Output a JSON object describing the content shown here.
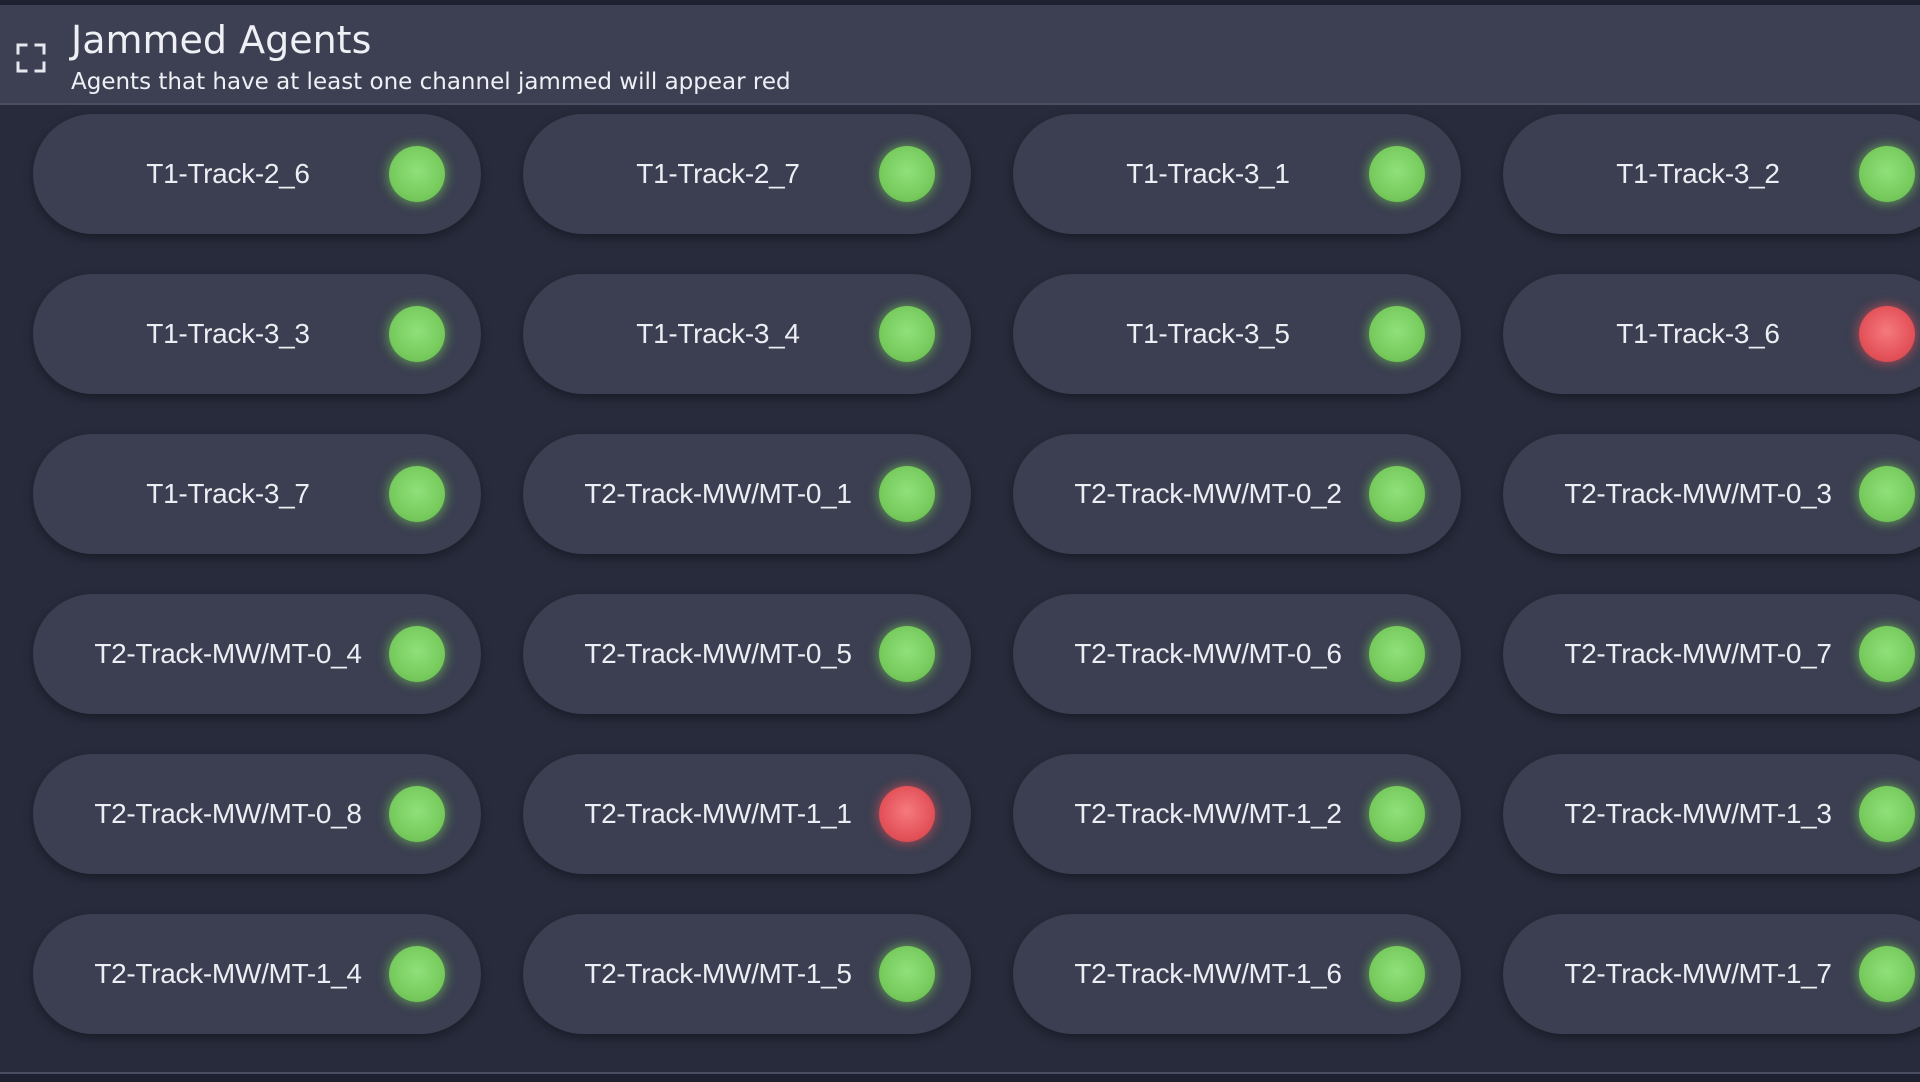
{
  "panel": {
    "title": "Jammed Agents",
    "subtitle": "Agents that have at least one channel jammed will appear red",
    "expand_icon": "expand-icon"
  },
  "colors": {
    "ok": "#78cc5e",
    "jammed": "#e4535a",
    "pill_background": "#3b3f51",
    "page_background": "#272b3b"
  },
  "agents": [
    {
      "name": "T1-Track-2_6",
      "status": "ok"
    },
    {
      "name": "T1-Track-2_7",
      "status": "ok"
    },
    {
      "name": "T1-Track-3_1",
      "status": "ok"
    },
    {
      "name": "T1-Track-3_2",
      "status": "ok"
    },
    {
      "name": "T1-Track-3_3",
      "status": "ok"
    },
    {
      "name": "T1-Track-3_4",
      "status": "ok"
    },
    {
      "name": "T1-Track-3_5",
      "status": "ok"
    },
    {
      "name": "T1-Track-3_6",
      "status": "jammed"
    },
    {
      "name": "T1-Track-3_7",
      "status": "ok"
    },
    {
      "name": "T2-Track-MW/MT-0_1",
      "status": "ok"
    },
    {
      "name": "T2-Track-MW/MT-0_2",
      "status": "ok"
    },
    {
      "name": "T2-Track-MW/MT-0_3",
      "status": "ok"
    },
    {
      "name": "T2-Track-MW/MT-0_4",
      "status": "ok"
    },
    {
      "name": "T2-Track-MW/MT-0_5",
      "status": "ok"
    },
    {
      "name": "T2-Track-MW/MT-0_6",
      "status": "ok"
    },
    {
      "name": "T2-Track-MW/MT-0_7",
      "status": "ok"
    },
    {
      "name": "T2-Track-MW/MT-0_8",
      "status": "ok"
    },
    {
      "name": "T2-Track-MW/MT-1_1",
      "status": "jammed"
    },
    {
      "name": "T2-Track-MW/MT-1_2",
      "status": "ok"
    },
    {
      "name": "T2-Track-MW/MT-1_3",
      "status": "ok"
    },
    {
      "name": "T2-Track-MW/MT-1_4",
      "status": "ok"
    },
    {
      "name": "T2-Track-MW/MT-1_5",
      "status": "ok"
    },
    {
      "name": "T2-Track-MW/MT-1_6",
      "status": "ok"
    },
    {
      "name": "T2-Track-MW/MT-1_7",
      "status": "ok"
    }
  ]
}
